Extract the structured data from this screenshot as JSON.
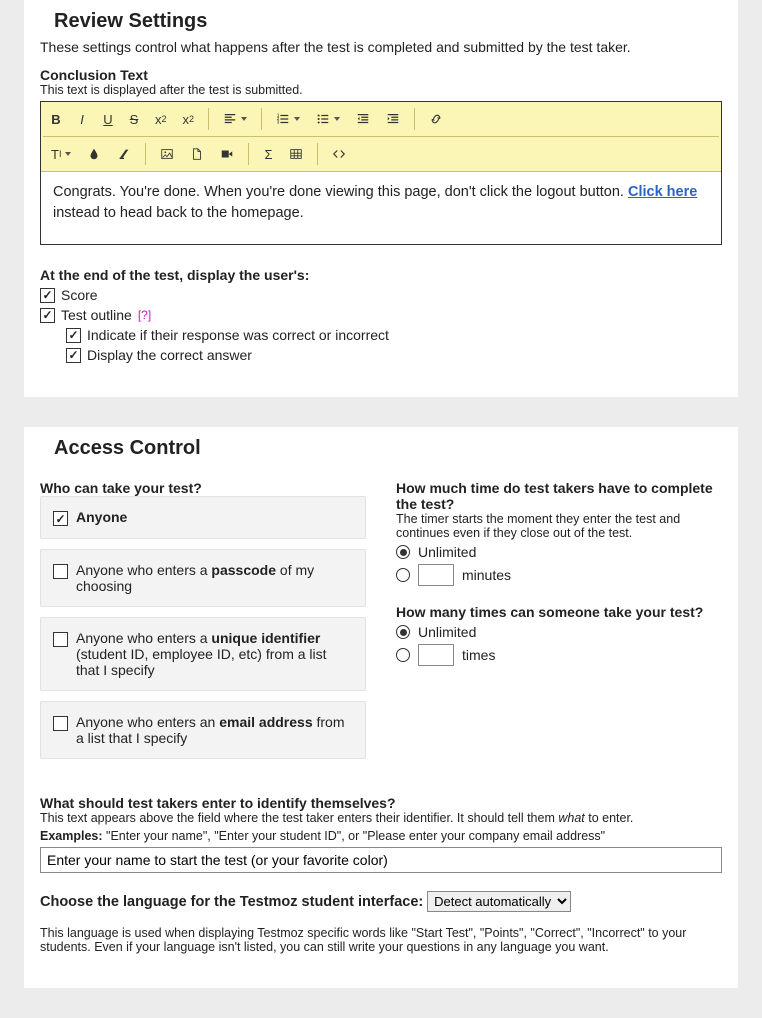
{
  "review": {
    "heading": "Review Settings",
    "desc": "These settings control what happens after the test is completed and submitted by the test taker.",
    "conclusion_label": "Conclusion Text",
    "conclusion_hint": "This text is displayed after the test is submitted.",
    "editor_text_pre": "Congrats. You're done. When you're done viewing this page, don't click the logout button. ",
    "editor_link": "Click here",
    "editor_text_post": " instead to head back to the homepage.",
    "end_label": "At the end of the test, display the user's:",
    "chk_score": "Score",
    "chk_outline": "Test outline",
    "help_q": "[?]",
    "chk_indicate": "Indicate if their response was correct or incorrect",
    "chk_correct": "Display the correct answer"
  },
  "access": {
    "heading": "Access Control",
    "who_q": "Who can take your test?",
    "opt_anyone": "Anyone",
    "opt_passcode_pre": "Anyone who enters a ",
    "opt_passcode_b": "passcode",
    "opt_passcode_post": " of my choosing",
    "opt_uid_pre": "Anyone who enters a ",
    "opt_uid_b": "unique identifier",
    "opt_uid_post": " (student ID, employee ID, etc) from a list that I specify",
    "opt_email_pre": "Anyone who enters an ",
    "opt_email_b": "email address",
    "opt_email_post": " from a list that I specify",
    "time_q": "How much time do test takers have to complete the test?",
    "time_hint": "The timer starts the moment they enter the test and continues even if they close out of the test.",
    "unlimited": "Unlimited",
    "minutes": "minutes",
    "attempts_q": "How many times can someone take your test?",
    "times": "times",
    "identify_q": "What should test takers enter to identify themselves?",
    "identify_hint_pre": "This text appears above the field where the test taker enters their identifier. It should tell them ",
    "identify_hint_i": "what",
    "identify_hint_post": " to enter.",
    "examples_label": "Examples:",
    "examples_text": " \"Enter your name\", \"Enter your student ID\", or \"Please enter your company email address\"",
    "identify_value": "Enter your name to start the test (or your favorite color)",
    "lang_label": "Choose the language for the Testmoz student interface:",
    "lang_selected": "Detect automatically",
    "lang_hint": "This language is used when displaying Testmoz specific words like \"Start Test\", \"Points\", \"Correct\", \"Incorrect\" to your students. Even if your language isn't listed, you can still write your questions in any language you want."
  }
}
